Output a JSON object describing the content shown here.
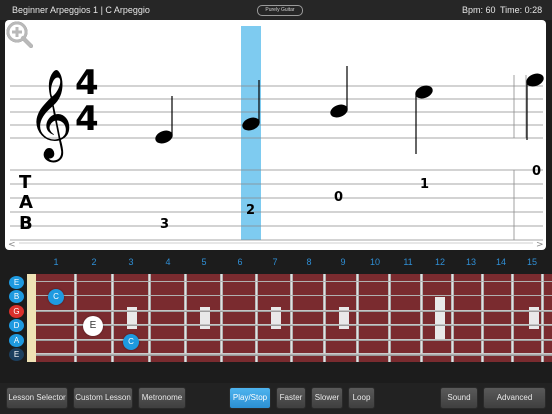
{
  "header": {
    "title": "Beginner Arpeggios 1 | C Arpeggio",
    "logo_text": "Purely Guitar",
    "bpm": "Bpm: 60",
    "time": "Time: 0:28"
  },
  "score": {
    "time_signature_top": "4",
    "time_signature_bottom": "4",
    "tab_letters": [
      "T",
      "A",
      "B"
    ],
    "tab_numbers": [
      "3",
      "2",
      "0",
      "1",
      "0"
    ],
    "scroll_left": "<",
    "scroll_right": ">"
  },
  "fretboard": {
    "fret_numbers": [
      "1",
      "2",
      "3",
      "4",
      "5",
      "6",
      "7",
      "8",
      "9",
      "10",
      "11",
      "12",
      "13",
      "14",
      "15"
    ],
    "string_labels": [
      {
        "label": "E",
        "color": "#1e9ae0"
      },
      {
        "label": "B",
        "color": "#1e9ae0"
      },
      {
        "label": "G",
        "color": "#d9302b"
      },
      {
        "label": "D",
        "color": "#1e9ae0"
      },
      {
        "label": "A",
        "color": "#1e9ae0"
      },
      {
        "label": "E",
        "color": "#1c3f5e"
      }
    ],
    "notes": [
      "C",
      "E",
      "C"
    ]
  },
  "toolbar": {
    "lesson_selector": "Lesson Selector",
    "custom_lesson": "Custom Lesson",
    "metronome": "Metronome",
    "play_stop": "Play/Stop",
    "faster": "Faster",
    "slower": "Slower",
    "loop": "Loop",
    "sound": "Sound",
    "advanced": "Advanced"
  },
  "colors": {
    "accent": "#2b8fd2",
    "highlight": "#7ecbf0",
    "fretboard": "#7a2b2f"
  }
}
